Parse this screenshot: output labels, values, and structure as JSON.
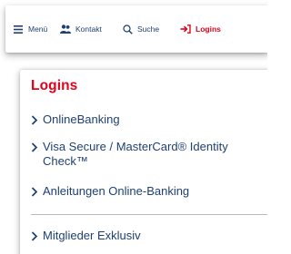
{
  "nav": {
    "menu_label": "Menü",
    "kontakt_label": "Kontakt",
    "suche_label": "Suche",
    "logins_label": "Logins"
  },
  "dropdown": {
    "title": "Logins",
    "links": [
      "OnlineBanking",
      "Visa Secure / MasterCard® Identity Check™",
      "Anleitungen Online-Banking",
      "Mitglieder Exklusiv"
    ]
  },
  "colors": {
    "brand_blue": "#1e3f73",
    "accent_red": "#e2001a"
  },
  "icons": {
    "menu": "hamburger-icon",
    "kontakt": "people-icon",
    "suche": "search-icon",
    "logins": "login-arrow-icon",
    "link": "chevron-right-icon"
  }
}
